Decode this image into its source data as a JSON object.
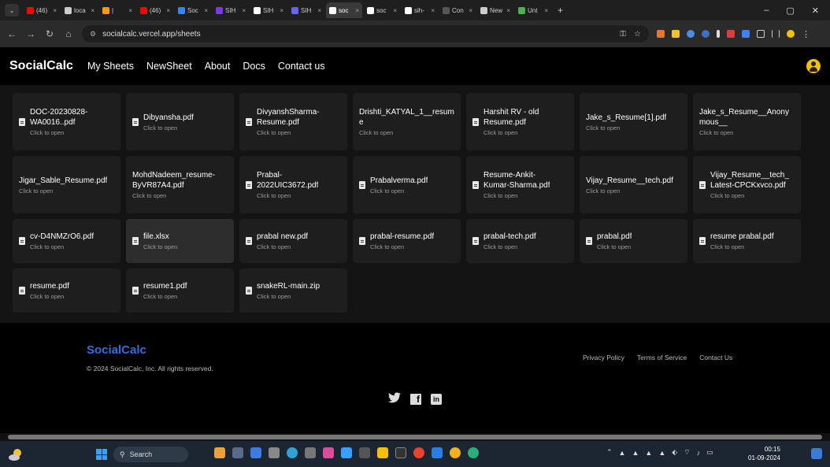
{
  "browser": {
    "tabs": [
      {
        "label": "(46)",
        "color": "#ff0000"
      },
      {
        "label": "loca",
        "color": "#cccccc"
      },
      {
        "label": "|",
        "color": "#ff9900"
      },
      {
        "label": "(46)",
        "color": "#ff0000"
      },
      {
        "label": "Soc",
        "color": "#3b82f6"
      },
      {
        "label": "SIH",
        "color": "#7c3aed"
      },
      {
        "label": "SIH",
        "color": "#ffffff"
      },
      {
        "label": "SIH",
        "color": "#6366f1"
      },
      {
        "label": "soc",
        "color": "#ffffff"
      },
      {
        "label": "soc",
        "color": "#ffffff"
      },
      {
        "label": "sih-",
        "color": "#ffffff"
      },
      {
        "label": "Con",
        "color": "#555555"
      },
      {
        "label": "New",
        "color": "#cccccc"
      },
      {
        "label": "Unt",
        "color": "#4caf50"
      }
    ],
    "active_tab_index": 8,
    "new_tab": "+",
    "minimize": "–",
    "restore": "▢",
    "close": "✕",
    "url": "socialcalc.vercel.app/sheets"
  },
  "nav": {
    "brand": "SocialCalc",
    "links": [
      "My Sheets",
      "NewSheet",
      "About",
      "Docs",
      "Contact us"
    ]
  },
  "files": [
    {
      "name": "DOC-20230828-\nWA0016..pdf",
      "sub": "Click to open"
    },
    {
      "name": "Dibyansha.pdf",
      "sub": "Click to open"
    },
    {
      "name": "DivyanshSharma-\nResume.pdf",
      "sub": "Click to open"
    },
    {
      "name": "Drishti_KATYAL_1__resume",
      "sub": "Click to open",
      "noicon": true
    },
    {
      "name": "Harshit RV - old\nResume.pdf",
      "sub": "Click to open"
    },
    {
      "name": "Jake_s_Resume[1].pdf",
      "sub": "Click to open",
      "noicon": true
    },
    {
      "name": "Jake_s_Resume__Anonymous__",
      "sub": "Click to open",
      "noicon": true
    },
    {
      "name": "Jigar_Sable_Resume.pdf",
      "sub": "Click to open",
      "noicon": true
    },
    {
      "name": "MohdNadeem_resume-\nByVR87A4.pdf",
      "sub": "Click to open",
      "noicon": true
    },
    {
      "name": "Prabal-\n2022UIC3672.pdf",
      "sub": "Click to open"
    },
    {
      "name": "Prabalverma.pdf",
      "sub": "Click to open"
    },
    {
      "name": "Resume-Ankit-\nKumar-Sharma.pdf",
      "sub": "Click to open"
    },
    {
      "name": "Vijay_Resume__tech.pdf",
      "sub": "Click to open",
      "noicon": true
    },
    {
      "name": "Vijay_Resume__tech_\nLatest-CPCKxvco.pdf",
      "sub": "Click to open"
    },
    {
      "name": "cv-D4NMZrO6.pdf",
      "sub": "Click to open"
    },
    {
      "name": "file.xlsx",
      "sub": "Click to open",
      "hover": true
    },
    {
      "name": "prabal new.pdf",
      "sub": "Click to open"
    },
    {
      "name": "prabal-resume.pdf",
      "sub": "Click to open"
    },
    {
      "name": "prabal-tech.pdf",
      "sub": "Click to open"
    },
    {
      "name": "prabal.pdf",
      "sub": "Click to open"
    },
    {
      "name": "resume prabal.pdf",
      "sub": "Click to open"
    },
    {
      "name": "resume.pdf",
      "sub": "Click to open"
    },
    {
      "name": "resume1.pdf",
      "sub": "Click to open"
    },
    {
      "name": "snakeRL-main.zip",
      "sub": "Click to open"
    }
  ],
  "footer": {
    "brand": "SocialCalc",
    "copyright": "© 2024 SocialCalc, Inc. All rights reserved.",
    "links": [
      "Privacy Policy",
      "Terms of Service",
      "Contact Us"
    ],
    "brand_color": "#2f6fe4"
  },
  "taskbar": {
    "search": "Search",
    "time": "00:15",
    "date": "01-09-2024"
  }
}
